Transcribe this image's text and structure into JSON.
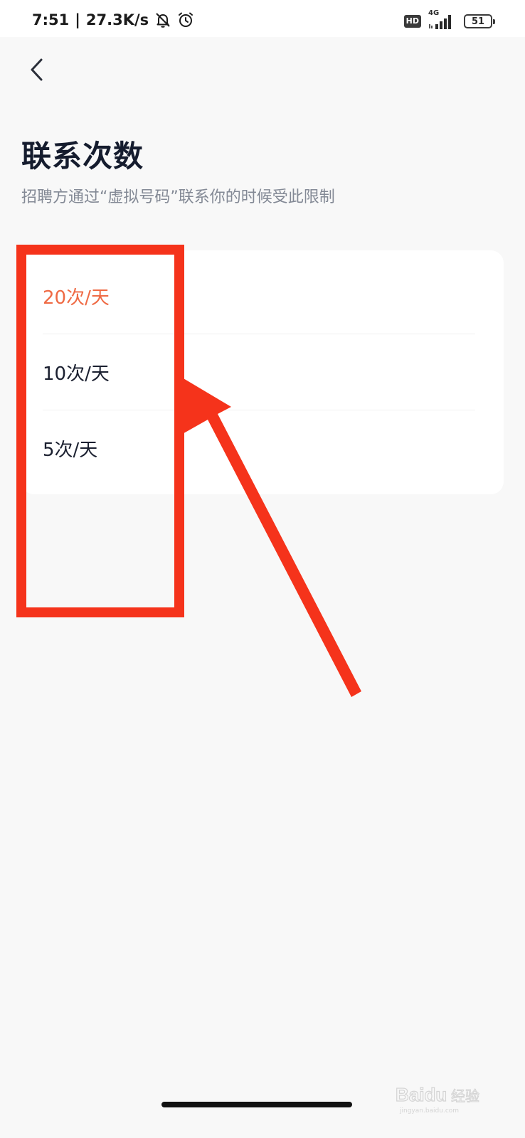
{
  "status_bar": {
    "time": "7:51",
    "separator": "|",
    "network_speed": "27.3K/s",
    "hd_label": "HD",
    "network_type": "4G",
    "battery_level": "51",
    "icons": [
      "mute-bell-icon",
      "alarm-clock-icon",
      "signal-bars-icon",
      "battery-icon"
    ]
  },
  "header": {
    "back_icon": "chevron-left-icon"
  },
  "page": {
    "title": "联系次数",
    "subtitle": "招聘方通过“虚拟号码”联系你的时候受此限制"
  },
  "options": [
    {
      "label": "20次/天",
      "selected": true
    },
    {
      "label": "10次/天",
      "selected": false
    },
    {
      "label": "5次/天",
      "selected": false
    }
  ],
  "colors": {
    "accent": "#ef6a44",
    "annotation": "#f5331b",
    "background": "#f8f8f8",
    "card": "#ffffff",
    "title": "#151c2e",
    "subtitle": "#838995"
  },
  "watermark": {
    "brand": "Baidu",
    "brand_cn": "经验",
    "domain": "jingyan.baidu.com"
  }
}
